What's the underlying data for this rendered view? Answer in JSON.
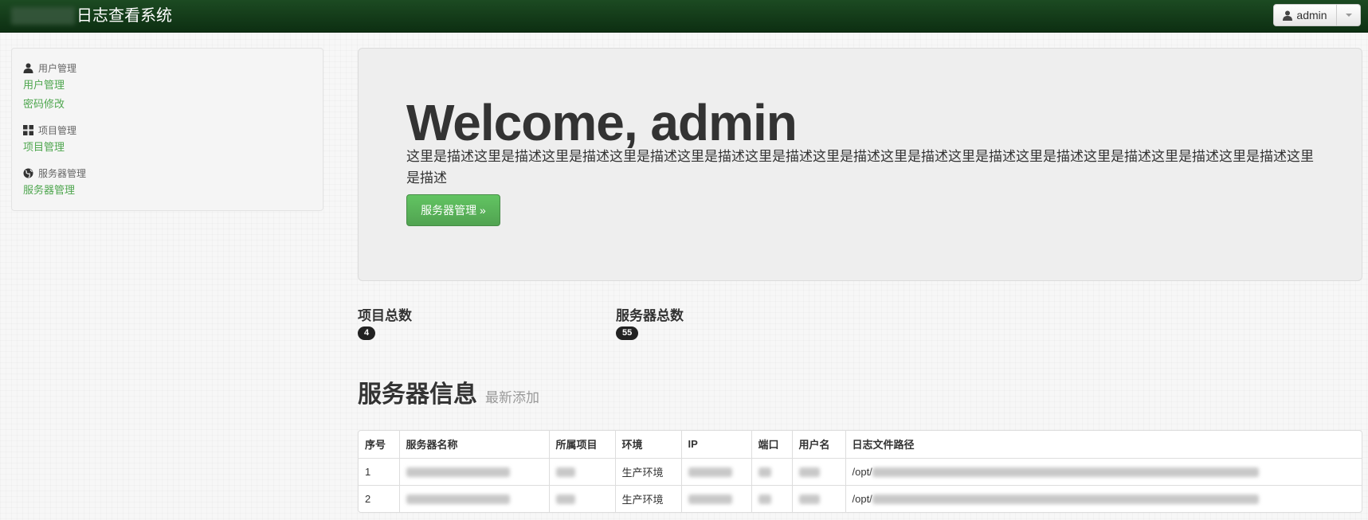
{
  "navbar": {
    "brand": "日志查看系统",
    "user_label": "admin",
    "user_icon": "user-icon"
  },
  "sidebar": {
    "sections": [
      {
        "header": "用户管理",
        "icon": "user-icon",
        "items": [
          "用户管理",
          "密码修改"
        ]
      },
      {
        "header": "项目管理",
        "icon": "grid-icon",
        "items": [
          "项目管理"
        ]
      },
      {
        "header": "服务器管理",
        "icon": "globe-icon",
        "items": [
          "服务器管理"
        ]
      }
    ]
  },
  "hero": {
    "title": "Welcome, admin",
    "description": "这里是描述这里是描述这里是描述这里是描述这里是描述这里是描述这里是描述这里是描述这里是描述这里是描述这里是描述这里是描述这里是描述这里是描述",
    "button": "服务器管理 »"
  },
  "stats": {
    "projects_label": "项目总数",
    "projects_count": "4",
    "servers_label": "服务器总数",
    "servers_count": "55"
  },
  "section": {
    "title": "服务器信息",
    "subtitle": "最新添加"
  },
  "table": {
    "headers": [
      "序号",
      "服务器名称",
      "所属项目",
      "环境",
      "IP",
      "端口",
      "用户名",
      "日志文件路径"
    ],
    "rows": [
      {
        "index": "1",
        "env": "生产环境",
        "path_prefix": "/opt/"
      },
      {
        "index": "2",
        "env": "生产环境",
        "path_prefix": "/opt/"
      }
    ]
  },
  "colors": {
    "navbar": "#0d2f12",
    "link": "#4ea64e",
    "button": "#5bb75b",
    "badge": "#222222"
  }
}
